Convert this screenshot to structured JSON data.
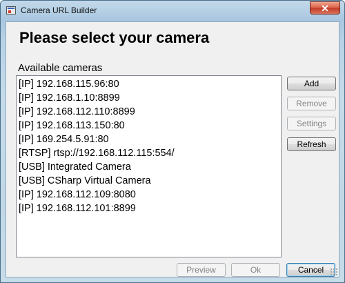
{
  "window": {
    "title": "Camera URL Builder",
    "close_symbol": "✕"
  },
  "main": {
    "heading": "Please select your camera",
    "cameras_label": "Available cameras"
  },
  "cameras": [
    "[IP] 192.168.115.96:80",
    "[IP] 192.168.1.10:8899",
    "[IP] 192.168.112.110:8899",
    "[IP] 192.168.113.150:80",
    "[IP] 169.254.5.91:80",
    "[RTSP] rtsp://192.168.112.115:554/",
    "[USB] Integrated Camera",
    "[USB] CSharp Virtual Camera",
    "[IP] 192.168.112.109:8080",
    "[IP] 192.168.112.101:8899"
  ],
  "side_buttons": {
    "add": "Add",
    "remove": "Remove",
    "settings": "Settings",
    "refresh": "Refresh"
  },
  "bottom_buttons": {
    "preview": "Preview",
    "ok": "Ok",
    "cancel": "Cancel"
  },
  "icons": {
    "app": "app-window-icon",
    "close": "close-icon",
    "grip": "resize-grip-icon"
  }
}
